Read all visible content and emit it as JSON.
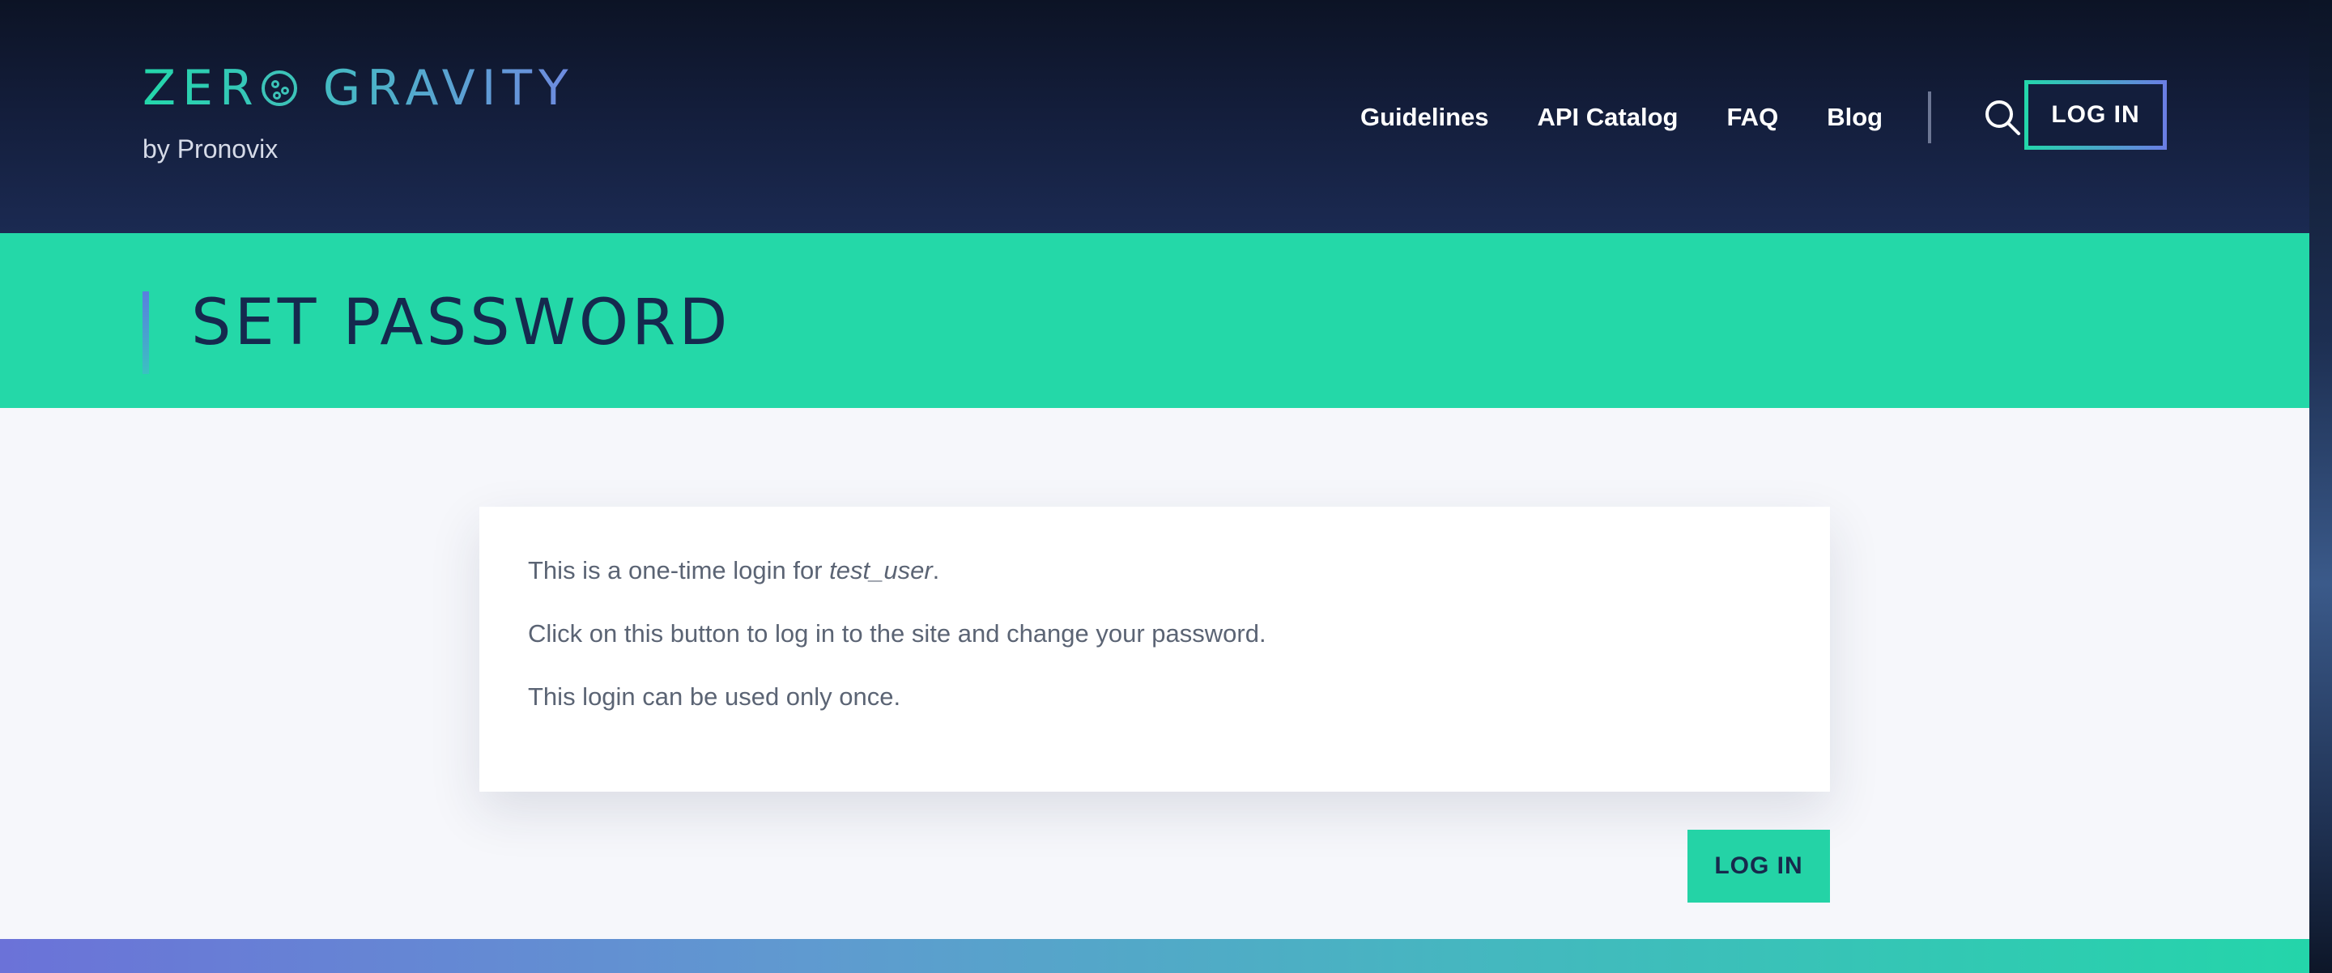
{
  "header": {
    "logo_text_left": "ZER",
    "logo_text_right": "GRAVITY",
    "logo_subtitle": "by Pronovix",
    "nav": [
      {
        "label": "Guidelines"
      },
      {
        "label": "API Catalog"
      },
      {
        "label": "FAQ"
      },
      {
        "label": "Blog"
      }
    ],
    "search_icon": "search-icon",
    "login_label": "LOG IN"
  },
  "title_band": {
    "title": "SET PASSWORD"
  },
  "content": {
    "line1_prefix": "This is a one-time login for ",
    "line1_user": "test_user",
    "line1_suffix": ".",
    "line2": "Click on this button to log in to the site and change your password.",
    "line3": "This login can be used only once.",
    "login_button": "LOG IN"
  },
  "colors": {
    "header_bg": "#131d3a",
    "accent_green": "#24d8a8",
    "title_text": "#15294e",
    "body_text": "#5b6474",
    "page_bg": "#f6f7fb"
  }
}
